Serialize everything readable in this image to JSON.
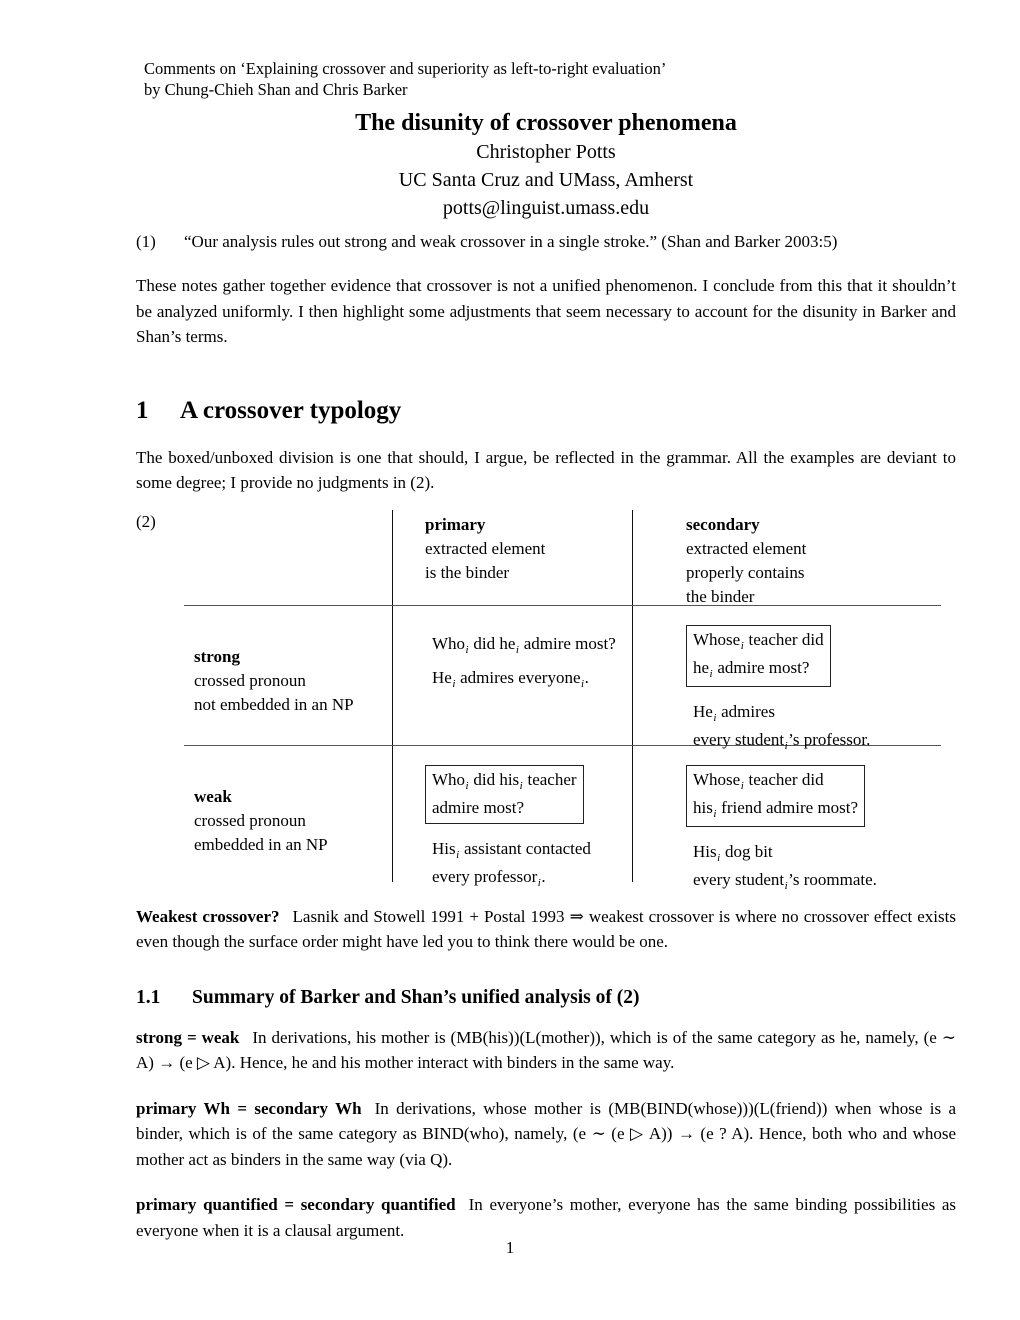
{
  "document": {
    "running_head_line1": "Comments on ‘Explaining crossover and superiority as left-to-right evaluation’",
    "running_head_line2": "by Chung-Chieh Shan and Chris Barker",
    "title": "The disunity of crossover phenomena",
    "author": "Christopher Potts",
    "affiliation": "UC Santa Cruz and UMass, Amherst",
    "email": "potts@linguist.umass.edu",
    "page_number": "1"
  },
  "example1": {
    "number": "(1)",
    "text": "“Our analysis rules out strong and weak crossover in a single stroke.” (Shan and Barker 2003:5)"
  },
  "intro_paragraph": "These notes gather together evidence that crossover is not a unified phenomenon. I conclude from this that it shouldn’t be analyzed uniformly. I then highlight some adjustments that seem necessary to account for the disunity in Barker and Shan’s terms.",
  "section1": {
    "number": "1",
    "title": "A crossover typology",
    "paragraph": "The boxed/unboxed division is one that should, I argue, be reflected in the grammar. All the examples are deviant to some degree; I provide no judgments in (2)."
  },
  "table2": {
    "number": "(2)",
    "columns": [
      {
        "title": "primary",
        "desc_line1": "extracted element",
        "desc_line2": "is the binder",
        "desc_line3": ""
      },
      {
        "title": "secondary",
        "desc_line1": "extracted element",
        "desc_line2": "properly contains",
        "desc_line3": "the binder"
      }
    ],
    "rows": [
      {
        "label_title": "strong",
        "label_line1": "crossed pronoun",
        "label_line2": "not embedded in an NP",
        "primary": {
          "boxed": false,
          "ex1_line1": "Who did he admire most?",
          "ex1_line2": "",
          "ex2_line1": "He admires everyone.",
          "ex2_line2": ""
        },
        "secondary": {
          "boxed": true,
          "ex1_line1": "Whose teacher did",
          "ex1_line2": "he admire most?",
          "ex2_line1": "He admires",
          "ex2_line2": "every student’s professor."
        }
      },
      {
        "label_title": "weak",
        "label_line1": "crossed pronoun",
        "label_line2": "embedded in an NP",
        "primary": {
          "boxed": true,
          "ex1_line1": "Who did his teacher",
          "ex1_line2": "admire most?",
          "ex2_line1": "His assistant contacted",
          "ex2_line2": "every professor."
        },
        "secondary": {
          "boxed": true,
          "ex1_line1": "Whose teacher did",
          "ex1_line2": "his friend admire most?",
          "ex2_line1": "His dog bit",
          "ex2_line2": "every student’s roommate."
        }
      }
    ]
  },
  "weakest": {
    "label": "Weakest crossover?",
    "text": "Lasnik and Stowell 1991 + Postal 1993 ⇒ weakest crossover is where no crossover effect exists even though the surface order might have led you to think there would be one."
  },
  "section11": {
    "number": "1.1",
    "title": "Summary of Barker and Shan’s unified analysis of (2)"
  },
  "defs": [
    {
      "label": "strong = weak",
      "text": "In derivations, his mother is (MB(his))(L(mother)), which is of the same category as he, namely, (e ∼ A) → (e ▷ A). Hence, he and his mother interact with binders in the same way."
    },
    {
      "label": "primary Wh = secondary Wh",
      "text": "In derivations, whose mother is (MB(BIND(whose)))(L(friend)) when whose is a binder, which is of the same category as BIND(who), namely, (e ∼ (e ▷ A)) → (e ? A). Hence, both who and whose mother act as binders in the same way (via Q)."
    },
    {
      "label": "primary quantified = secondary quantified",
      "text": "In everyone’s mother, everyone has the same binding possibilities as everyone when it is a clausal argument."
    }
  ]
}
